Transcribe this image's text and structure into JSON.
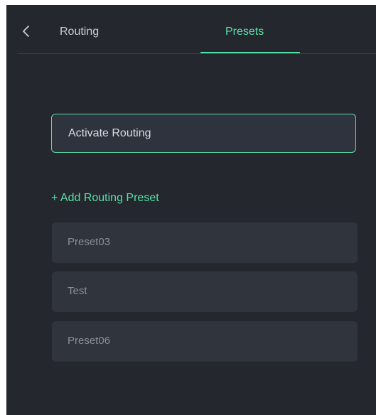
{
  "header": {
    "tabs": [
      {
        "label": "Routing",
        "active": false
      },
      {
        "label": "Presets",
        "active": true
      }
    ],
    "back_icon": "chevron-left-icon"
  },
  "main": {
    "activate_button_label": "Activate Routing",
    "add_preset_label": "+ Add Routing Preset",
    "presets": [
      {
        "label": "Preset03"
      },
      {
        "label": "Test"
      },
      {
        "label": "Preset06"
      }
    ]
  },
  "colors": {
    "background": "#24272e",
    "accent": "#57e0a4",
    "item_background": "#30343d",
    "text_primary": "#d8dbe0",
    "text_muted": "#8a8f99"
  }
}
